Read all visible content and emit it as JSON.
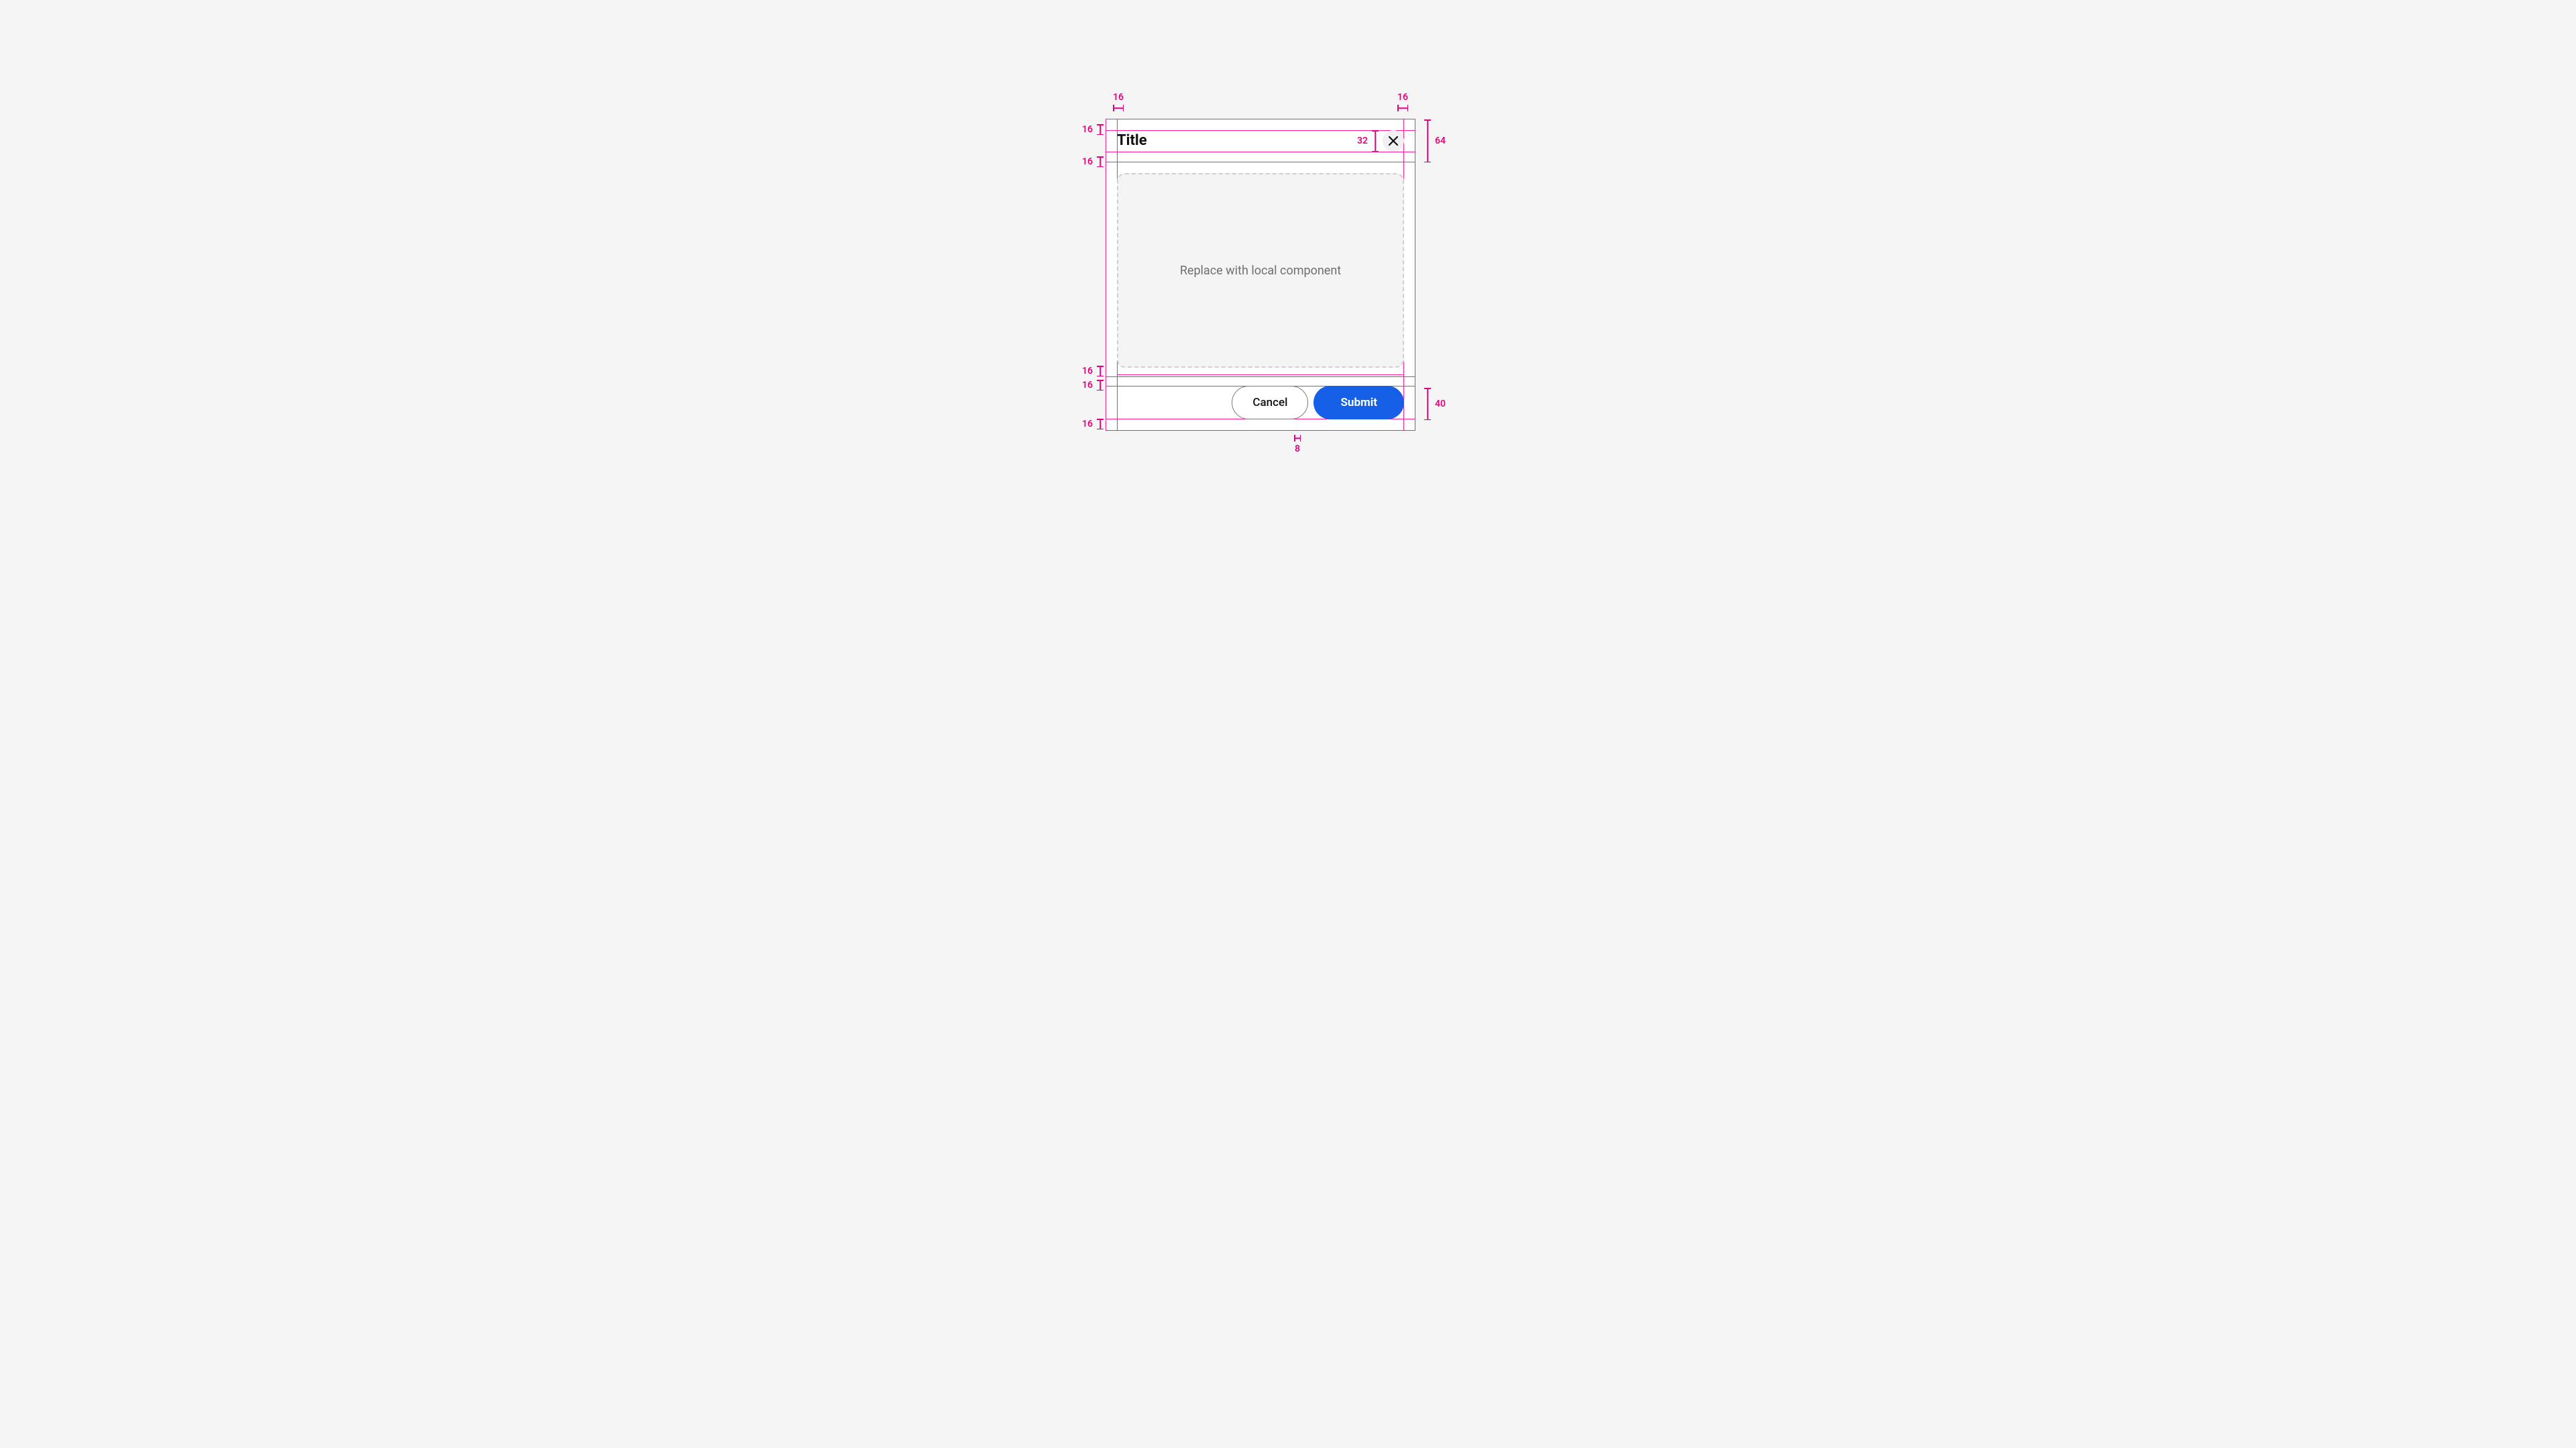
{
  "modal": {
    "title": "Title",
    "placeholder_text": "Replace with local component",
    "buttons": {
      "cancel": "Cancel",
      "submit": "Submit"
    }
  },
  "redlines": {
    "top_left_h": "16",
    "top_right_h": "16",
    "header_left_v": "16",
    "header_gap_v": "16",
    "header_right_height": "64",
    "close_size": "32",
    "footer_top_gap": "16",
    "footer_inner_gap": "16",
    "footer_bottom_gap": "16",
    "footer_button_gap": "8",
    "button_height": "40"
  },
  "colors": {
    "redline": "#e6007e",
    "primary_button": "#1560e6"
  }
}
